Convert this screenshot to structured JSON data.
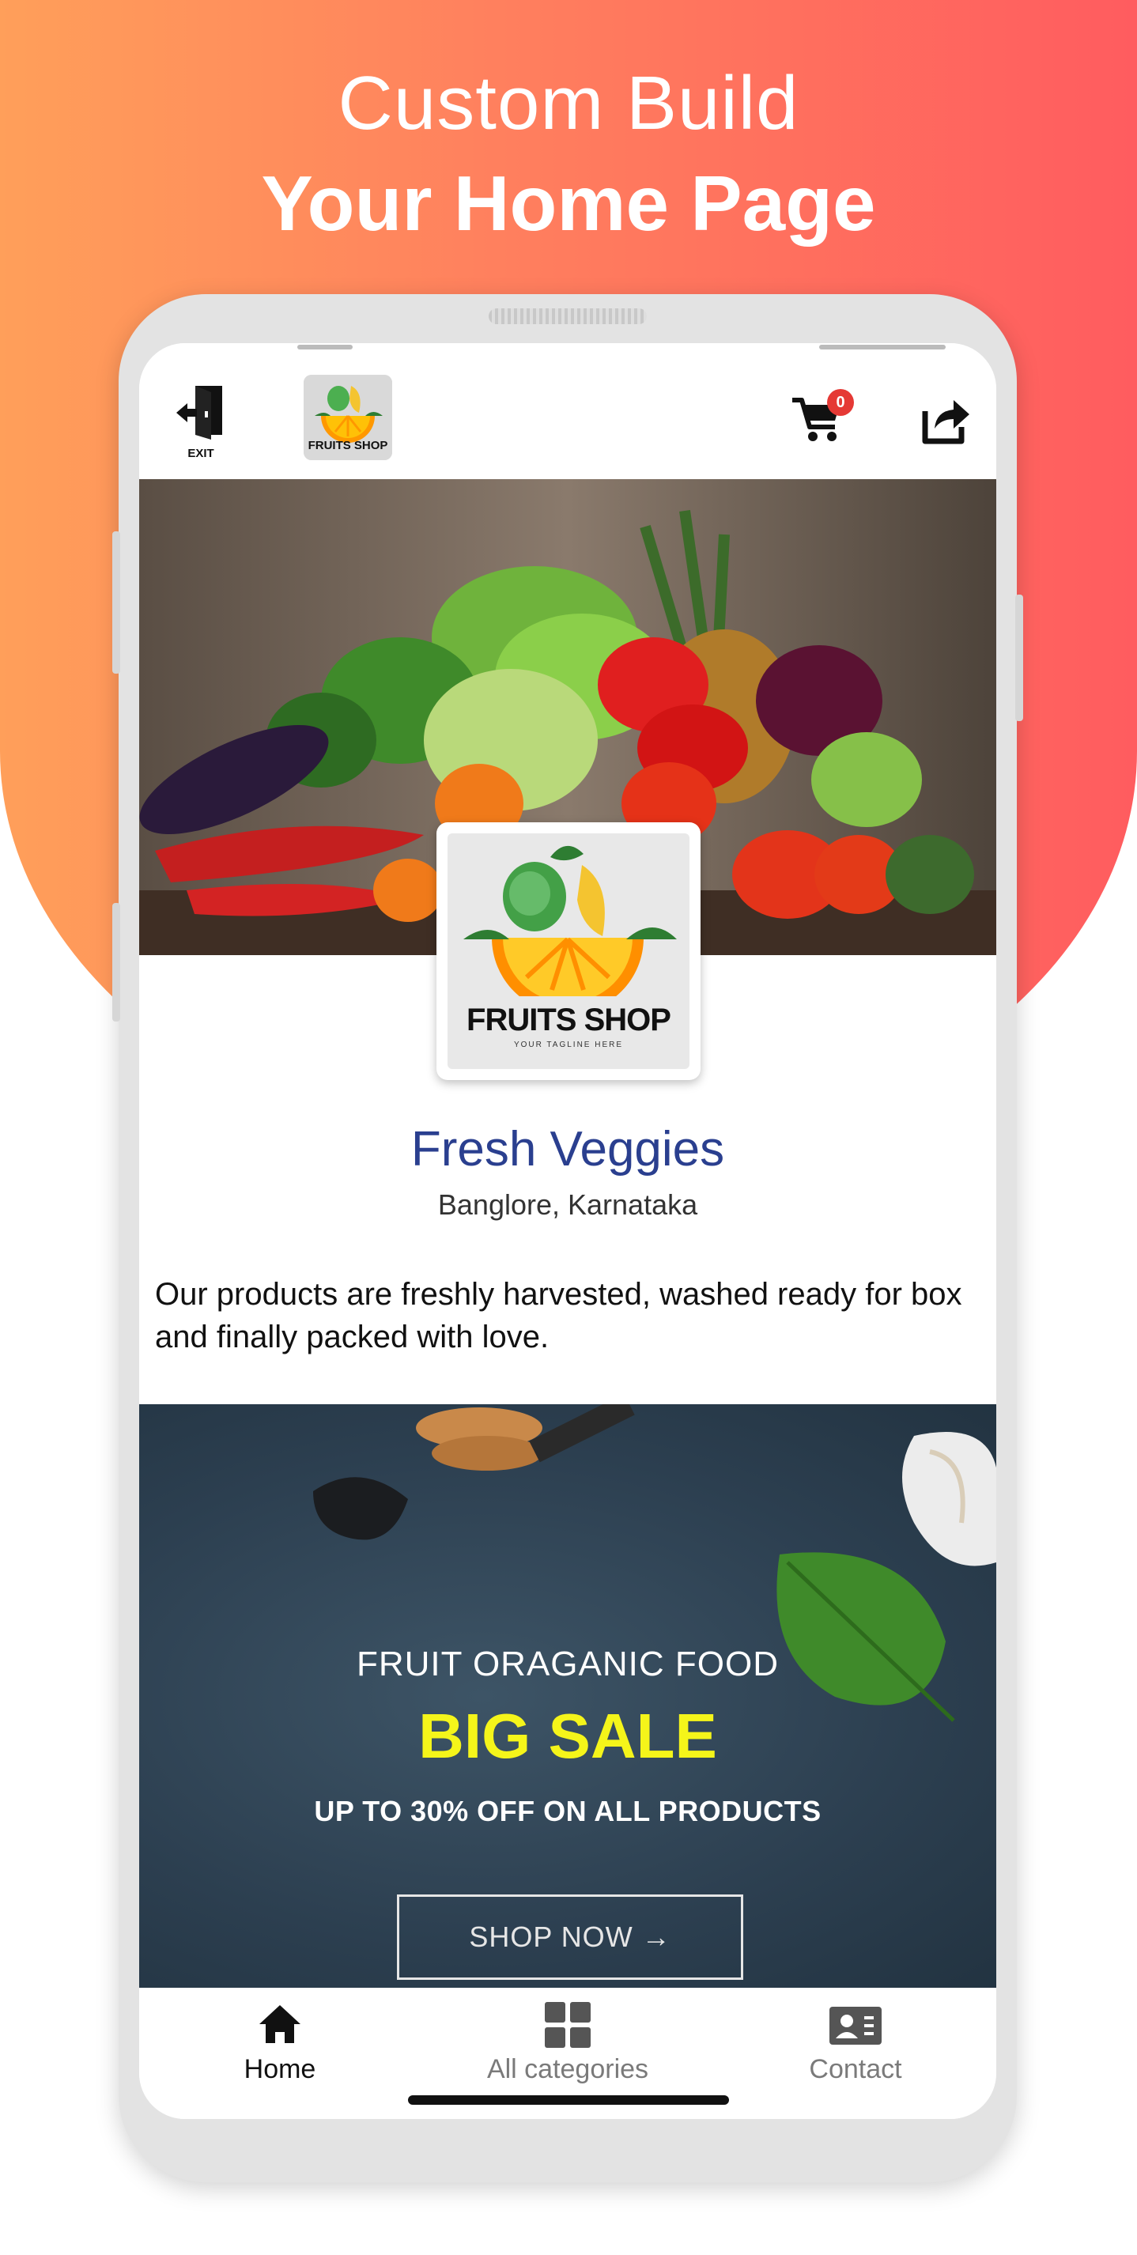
{
  "promo": {
    "headline_line1": "Custom Build",
    "headline_line2": "Your Home Page",
    "gradient_start": "#ff9f5a",
    "gradient_end": "#ff5c5f"
  },
  "appbar": {
    "exit_label": "EXIT",
    "logo_icon": "fruits-shop-logo",
    "cart_icon": "cart-icon",
    "cart_count": "0",
    "share_icon": "share-icon"
  },
  "store": {
    "logo_text": "FRUITS SHOP",
    "logo_tagline": "YOUR TAGLINE HERE",
    "name": "Fresh Veggies",
    "location": "Banglore, Karnataka",
    "description": "Our products are freshly harvested, washed ready for box and finally packed with love.",
    "name_color": "#2a3f8f"
  },
  "banner": {
    "line1": "FRUIT ORAGANIC FOOD",
    "headline": "BIG SALE",
    "subline": "UP TO 30% OFF ON ALL PRODUCTS",
    "cta": "SHOP NOW →",
    "headline_color": "#f5f51a"
  },
  "bottom_nav": {
    "items": [
      {
        "label": "Home",
        "icon": "home-icon",
        "active": true
      },
      {
        "label": "All categories",
        "icon": "grid-icon",
        "active": false
      },
      {
        "label": "Contact",
        "icon": "contact-card-icon",
        "active": false
      }
    ]
  }
}
